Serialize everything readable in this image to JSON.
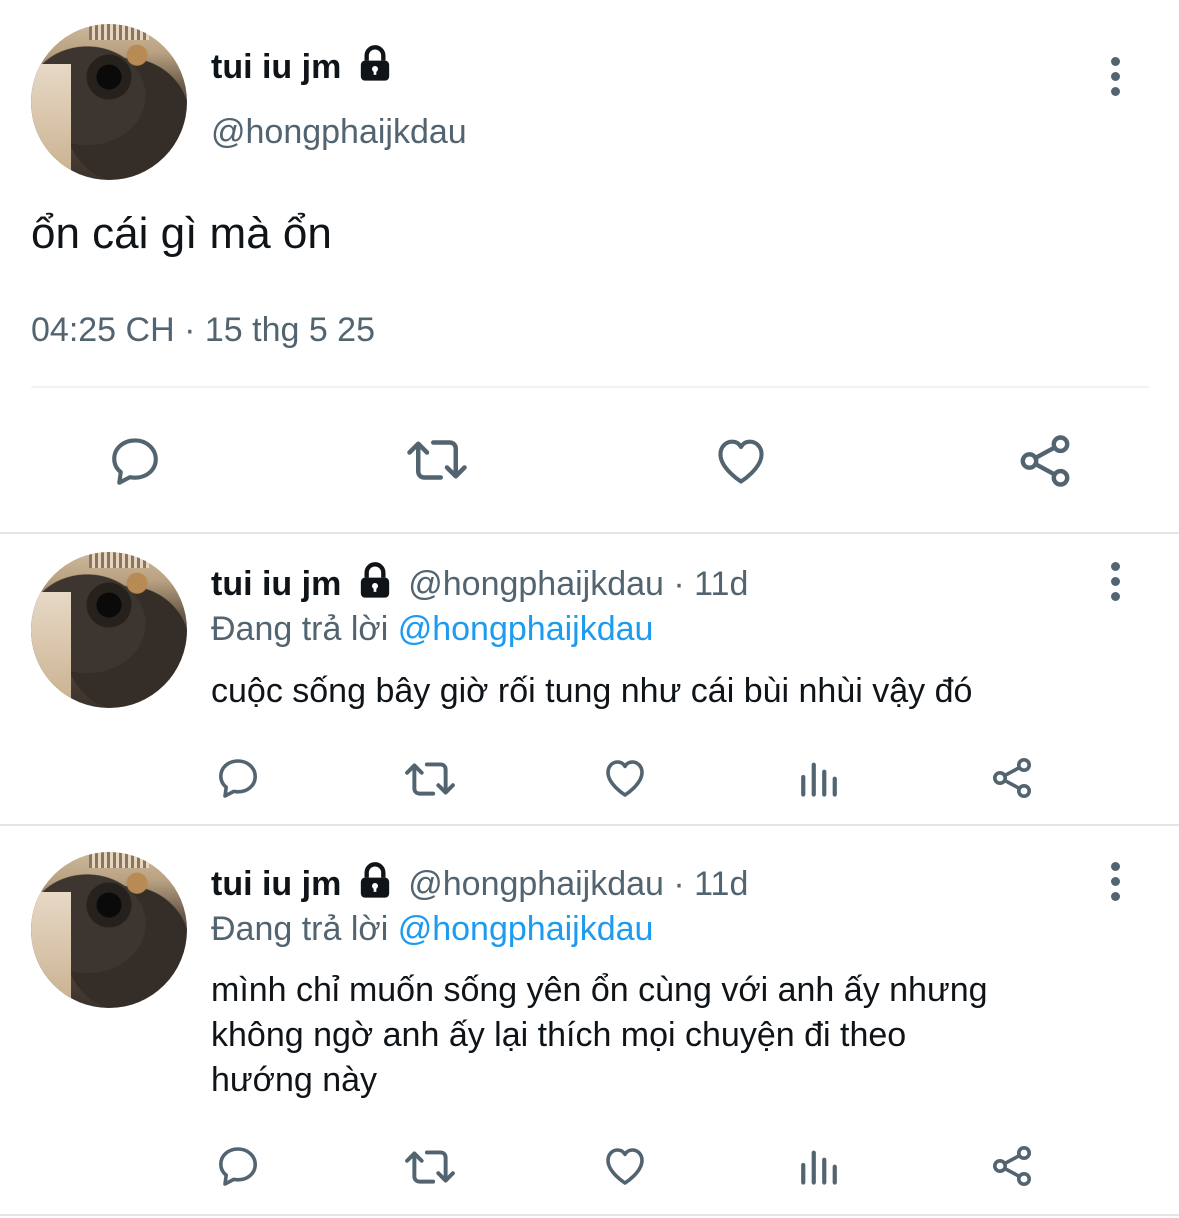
{
  "main_tweet": {
    "display_name": "tui iu jm",
    "handle": "@hongphaijkdau",
    "text": "ổn cái gì mà ổn",
    "timestamp": "04:25 CH · 15 thg 5 25"
  },
  "replies": [
    {
      "display_name": "tui iu jm",
      "handle": "@hongphaijkdau",
      "age": "· 11d",
      "replying_prefix": "Đang trả lời",
      "replying_to": "@hongphaijkdau",
      "text": "cuộc sống bây giờ rối tung như cái bùi nhùi vậy đó"
    },
    {
      "display_name": "tui iu jm",
      "handle": "@hongphaijkdau",
      "age": "· 11d",
      "replying_prefix": "Đang trả lời",
      "replying_to": "@hongphaijkdau",
      "text_lines": [
        "mình chỉ muốn sống yên ổn cùng với anh ấy nhưng",
        "không ngờ anh ấy lại thích mọi chuyện đi theo",
        "hướng này"
      ]
    }
  ],
  "icons": {
    "main_actions": [
      "reply-icon",
      "retweet-icon",
      "like-icon",
      "share-icon"
    ],
    "reply_actions": [
      "reply-icon",
      "retweet-icon",
      "like-icon",
      "analytics-icon",
      "share-icon"
    ],
    "misc": [
      "lock-icon",
      "more-options-icon",
      "avatar"
    ]
  },
  "colors": {
    "text": "#0f1419",
    "secondary": "#536471",
    "link": "#1d9bf0",
    "divider": "#eff3f4"
  }
}
